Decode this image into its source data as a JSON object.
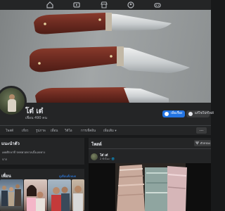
{
  "topnav": {
    "icons": [
      "home-icon",
      "video-icon",
      "marketplace-icon",
      "groups-icon",
      "gaming-icon"
    ]
  },
  "profile": {
    "name": "โต๋ เต๋",
    "friends_count": "เพื่อน 490 คน",
    "add_story_label": "เพิ่มเรื่อง",
    "edit_profile_label": "แก้ไขโปรไฟล์"
  },
  "tabs": [
    {
      "label": "โพสต์",
      "icon": "none"
    },
    {
      "label": "เกี่ยว",
      "icon": "none"
    },
    {
      "label": "รูปภาพ",
      "icon": "none"
    },
    {
      "label": "เพื่อน",
      "icon": "none"
    },
    {
      "label": "วิดีโอ",
      "icon": "none"
    },
    {
      "label": "การเช็คอิน",
      "icon": "none"
    },
    {
      "label": "เพิ่มเติม ▾",
      "icon": "chevron-down-icon"
    }
  ],
  "tabs_more": "...",
  "about": {
    "title": "แนะนำตัว",
    "rows": [
      "เคยศึกษาที่ รพชพวตทาลเบิ้งเลยทาง",
      "จาก"
    ]
  },
  "friends_section": {
    "title": "เพื่อน",
    "see_all": "ดูเพื่อนทั้งหมด"
  },
  "posts": {
    "title": "โพสต์",
    "filter_label": "ตัวกรอง",
    "author": "โต๋ เต๋",
    "time": "2 ชั่วโมง · 🌐"
  },
  "colors": {
    "background": "#18191a",
    "card": "#242526",
    "accent": "#2374e1",
    "link": "#2d88ff"
  }
}
